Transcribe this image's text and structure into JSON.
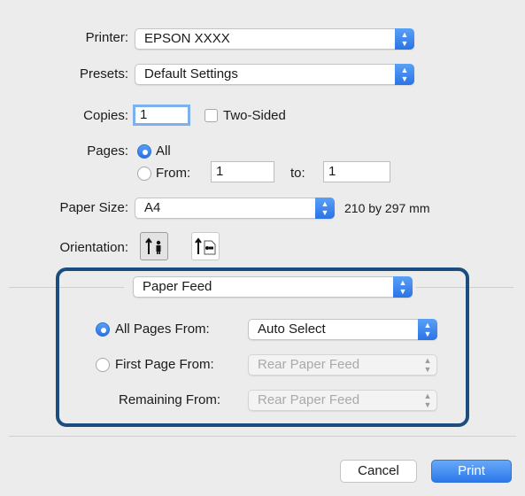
{
  "printer": {
    "label": "Printer:",
    "value": "EPSON XXXX"
  },
  "presets": {
    "label": "Presets:",
    "value": "Default Settings"
  },
  "copies": {
    "label": "Copies:",
    "value": "1",
    "two_sided_label": "Two-Sided"
  },
  "pages": {
    "label": "Pages:",
    "all_label": "All",
    "from_label": "From:",
    "from_value": "1",
    "to_label": "to:",
    "to_value": "1"
  },
  "paper_size": {
    "label": "Paper Size:",
    "value": "A4",
    "dimensions": "210 by 297 mm"
  },
  "orientation": {
    "label": "Orientation:"
  },
  "section": {
    "value": "Paper Feed"
  },
  "paper_feed": {
    "all_pages_label": "All Pages From:",
    "all_pages_value": "Auto Select",
    "first_page_label": "First Page From:",
    "first_page_value": "Rear Paper Feed",
    "remaining_label": "Remaining From:",
    "remaining_value": "Rear Paper Feed"
  },
  "buttons": {
    "cancel": "Cancel",
    "print": "Print"
  }
}
